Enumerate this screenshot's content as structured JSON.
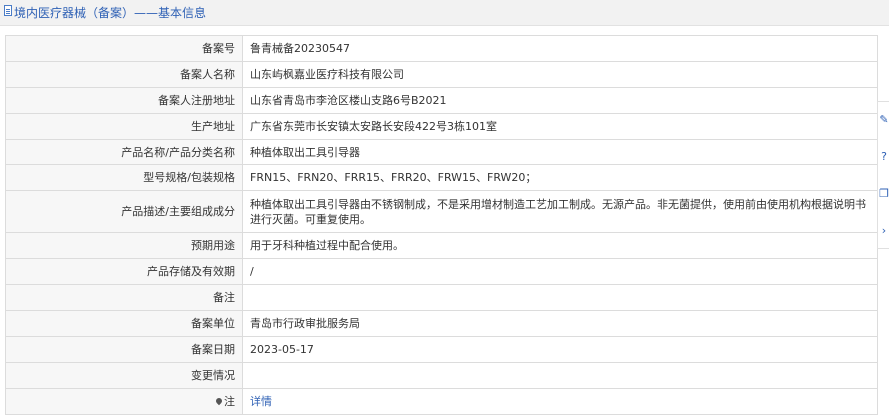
{
  "header": {
    "title": "境内医疗器械（备案）——基本信息"
  },
  "rows": [
    {
      "label": "备案号",
      "value": "鲁青械备20230547"
    },
    {
      "label": "备案人名称",
      "value": "山东屿枫嘉业医疗科技有限公司"
    },
    {
      "label": "备案人注册地址",
      "value": "山东省青岛市李沧区楼山支路6号B2021"
    },
    {
      "label": "生产地址",
      "value": "广东省东莞市长安镇太安路长安段422号3栋101室"
    },
    {
      "label": "产品名称/产品分类名称",
      "value": "种植体取出工具引导器"
    },
    {
      "label": "型号规格/包装规格",
      "value": "FRN15、FRN20、FRR15、FRR20、FRW15、FRW20；"
    },
    {
      "label": "产品描述/主要组成成分",
      "value": "种植体取出工具引导器由不锈钢制成，不是采用增材制造工艺加工制成。无源产品。非无菌提供，使用前由使用机构根据说明书进行灭菌。可重复使用。"
    },
    {
      "label": "预期用途",
      "value": "用于牙科种植过程中配合使用。"
    },
    {
      "label": "产品存储及有效期",
      "value": "/"
    },
    {
      "label": "备注",
      "value": ""
    },
    {
      "label": "备案单位",
      "value": "青岛市行政审批服务局"
    },
    {
      "label": "备案日期",
      "value": "2023-05-17"
    },
    {
      "label": "变更情况",
      "value": ""
    }
  ],
  "note": {
    "label": "注",
    "link": "详情"
  },
  "side_tools": [
    "edit-icon",
    "help-icon",
    "copy-icon",
    "chevron-right-icon"
  ]
}
